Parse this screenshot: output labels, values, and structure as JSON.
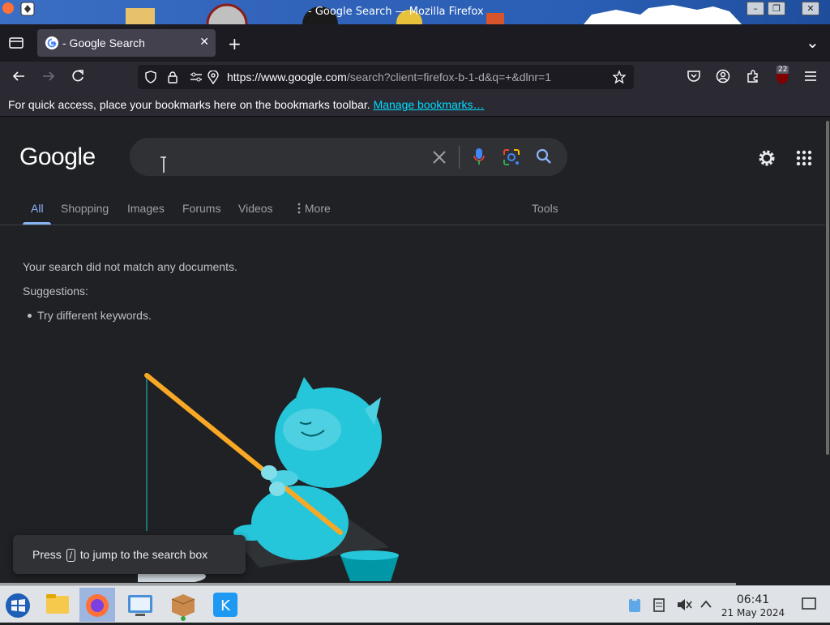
{
  "window": {
    "title": "- Google Search — Mozilla Firefox",
    "buttons": [
      "–",
      "❐",
      "✕"
    ]
  },
  "browser": {
    "tab_title": "- Google Search",
    "tab_close": "✕",
    "new_tab": "+",
    "list_tabs": "⌄",
    "url_domain": "https://www.google.com",
    "url_rest": "/search?client=firefox-b-1-d&q=+&dlnr=1",
    "extensions_badge": "22",
    "bookmarks_msg": "For quick access, place your bookmarks here on the bookmarks toolbar.",
    "bookmarks_link": "Manage bookmarks…"
  },
  "google": {
    "logo": "Google",
    "search_value": "",
    "tabs": [
      "All",
      "Shopping",
      "Images",
      "Forums",
      "Videos",
      "More"
    ],
    "tools": "Tools",
    "no_match": "Your search did not match any documents.",
    "suggestions_label": "Suggestions:",
    "suggestion_1": "Try different keywords.",
    "toast_before": "Press",
    "toast_key": "/",
    "toast_after": "to jump to the search box"
  },
  "taskbar": {
    "time": "06:41",
    "date": "21 May 2024"
  },
  "colors": {
    "accent": "#8ab4f8",
    "page_bg": "#202124",
    "link": "#00ddff"
  }
}
